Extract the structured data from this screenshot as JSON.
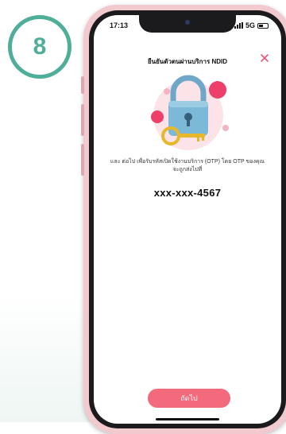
{
  "step": {
    "number": "8"
  },
  "status_bar": {
    "time": "17:13",
    "network": "5G"
  },
  "header": {
    "title": "ยืนยันตัวตนผ่านบริการ NDID",
    "close_icon": "close-icon"
  },
  "content": {
    "message": "และ ต่อไป เพื่อรับรหัสเปิดใช้งานบริการ (OTP) โดย OTP ของคุณจะถูกส่งไปที่",
    "phone_number": "xxx-xxx-4567",
    "illustration_icon": "padlock-key-icon"
  },
  "actions": {
    "next_label": "ถัดไป"
  },
  "colors": {
    "accent": "#f26a7c",
    "badge": "#4fae98",
    "frame": "#f2c9cf"
  }
}
